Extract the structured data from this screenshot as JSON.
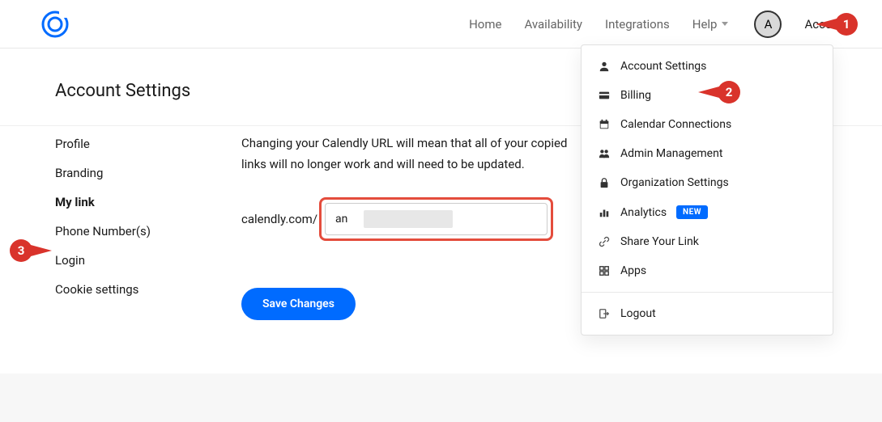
{
  "header": {
    "nav": {
      "home": "Home",
      "availability": "Availability",
      "integrations": "Integrations",
      "help": "Help"
    },
    "avatar_initial": "A",
    "account_label": "Account"
  },
  "page": {
    "title": "Account Settings"
  },
  "sidebar": {
    "items": [
      {
        "label": "Profile",
        "active": false
      },
      {
        "label": "Branding",
        "active": false
      },
      {
        "label": "My link",
        "active": true
      },
      {
        "label": "Phone Number(s)",
        "active": false
      },
      {
        "label": "Login",
        "active": false
      },
      {
        "label": "Cookie settings",
        "active": false
      }
    ]
  },
  "main": {
    "description": "Changing your Calendly URL will mean that all of your copied links will no longer work and will need to be updated.",
    "url_prefix": "calendly.com/",
    "url_value": "an",
    "save_label": "Save Changes"
  },
  "dropdown": {
    "items": [
      {
        "icon": "person-icon",
        "label": "Account Settings"
      },
      {
        "icon": "card-icon",
        "label": "Billing"
      },
      {
        "icon": "calendar-icon",
        "label": "Calendar Connections"
      },
      {
        "icon": "people-icon",
        "label": "Admin Management"
      },
      {
        "icon": "lock-icon",
        "label": "Organization Settings"
      },
      {
        "icon": "chart-icon",
        "label": "Analytics",
        "badge": "NEW"
      },
      {
        "icon": "link-icon",
        "label": "Share Your Link"
      },
      {
        "icon": "grid-icon",
        "label": "Apps"
      }
    ],
    "logout_label": "Logout"
  },
  "callouts": {
    "one": "1",
    "two": "2",
    "three": "3"
  }
}
